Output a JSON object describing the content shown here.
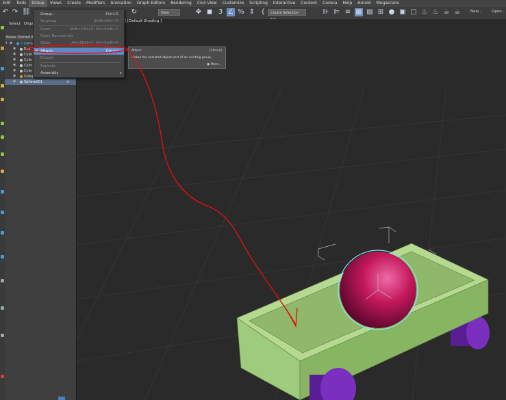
{
  "menubar": {
    "items": [
      "Edit",
      "Tools",
      "Group",
      "Views",
      "Create",
      "Modifiers",
      "Animation",
      "Graph Editors",
      "Rendering",
      "Civil View",
      "Customize",
      "Scripting",
      "Interactive",
      "Content",
      "Corona",
      "Help",
      "Arnold",
      "Megascans"
    ]
  },
  "toolbar": {
    "view_dropdown": "View",
    "selection_set_dropdown": "Create Selection Set",
    "new_label": "New...",
    "open_label": "Open..."
  },
  "scene_explorer": {
    "tab_select": "Select",
    "tab_display": "Displ",
    "header": "Name (Sorted As",
    "rows": [
      {
        "label": "0 (defa"
      },
      {
        "label": "Box"
      },
      {
        "label": "Cylin"
      },
      {
        "label": "Cylin"
      },
      {
        "label": "Cylin"
      },
      {
        "label": "Cylin"
      },
      {
        "label": "Group..."
      },
      {
        "label": "Sphere001"
      }
    ]
  },
  "viewport": {
    "label": "] [Default Shading ]"
  },
  "group_menu": {
    "items": [
      {
        "label": "Group...",
        "shortcut": "Ctrl+G",
        "state": "enabled"
      },
      {
        "label": "Ungroup",
        "shortcut": "Shift+Ctrl+G",
        "state": "disabled"
      },
      {
        "label": "Open",
        "shortcut": "Shift+Ctrl+E, Alt+Shift+X",
        "state": "disabled"
      },
      {
        "label": "Open Recursively",
        "shortcut": "",
        "state": "disabled"
      },
      {
        "label": "Close",
        "shortcut": "Alt+Shift+F, Alt+Shift+A",
        "state": "disabled"
      },
      {
        "label": "Attach",
        "shortcut": "Ctrl+U",
        "state": "highlight"
      },
      {
        "label": "Detach",
        "shortcut": "",
        "state": "disabled"
      },
      {
        "label": "Explode",
        "shortcut": "",
        "state": "disabled"
      },
      {
        "label": "Assembly",
        "shortcut": "",
        "state": "enabled"
      }
    ]
  },
  "tooltip": {
    "title": "Attach",
    "shortcut": "(Ctrl+U)",
    "description": "Makes the selected object part of an existing group.",
    "more": "More..."
  },
  "colors": {
    "highlight": "#5d89c6",
    "box": "#9fcb7c",
    "sphere": "#c2185b",
    "wheels": "#7b2fbe",
    "annotation": "#e01010",
    "selection": "#7fe8f0"
  },
  "icons": {
    "undo": "undo-icon",
    "redo": "redo-icon",
    "link": "link-icon",
    "rotate": "rotate-icon",
    "move": "move-icon",
    "scale": "scale-icon",
    "snap": "snap-icon",
    "percent": "percent-snap-icon",
    "spinner": "spinner-snap-icon",
    "edit_named": "edit-named-selection-icon",
    "teapot": "teapot-icon",
    "eye": "eye-icon"
  }
}
